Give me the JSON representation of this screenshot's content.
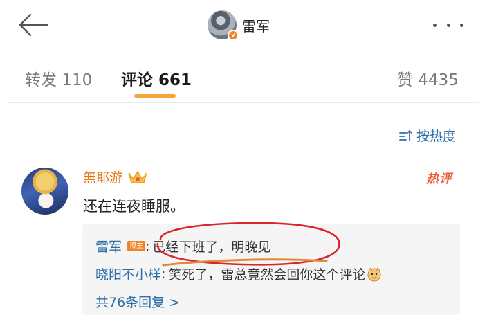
{
  "header": {
    "title": "雷军",
    "back_icon": "arrow-left-icon",
    "more_icon": "more-dots-icon",
    "verify_badge": "v"
  },
  "tabs": [
    {
      "label": "转发 110",
      "active": false
    },
    {
      "label": "评论 661",
      "active": true
    },
    {
      "label": "赞 4435",
      "active": false
    }
  ],
  "sort": {
    "label": "按热度",
    "icon": "sort-icon"
  },
  "comment": {
    "username": "無耶游",
    "badge_icon": "crown-icon",
    "hot_label": "热评",
    "text": "还在连夜睡服。",
    "replies": [
      {
        "name": "雷军",
        "tag": "博主",
        "separator": ":",
        "text": "已经下班了，明晚见"
      },
      {
        "name": "晓阳不小样",
        "separator": ":",
        "text": "笑死了，雷总竟然会回你这个评论"
      }
    ],
    "more_replies": "共76条回复 >"
  },
  "colors": {
    "accent_orange": "#f7a33d",
    "link_blue": "#2c6ea9",
    "username_orange": "#e36f00",
    "annotation_red": "#d9262c"
  }
}
